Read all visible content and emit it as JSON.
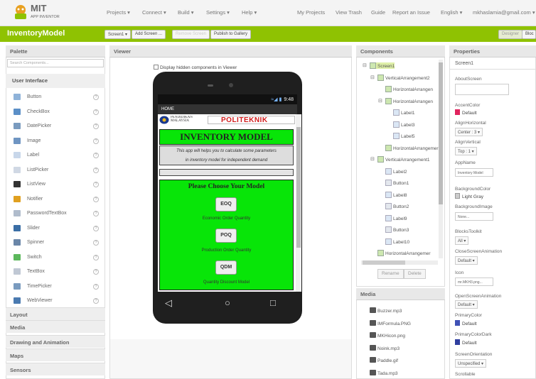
{
  "topbar": {
    "logo_mit": "MIT",
    "logo_sub": "APP INVENTOR",
    "menus": [
      "Projects ▾",
      "Connect ▾",
      "Build ▾",
      "Settings ▾",
      "Help ▾"
    ],
    "right_links": [
      "My Projects",
      "View Trash",
      "Guide",
      "Report an Issue",
      "English ▾",
      "mkhaslamia@gmail.com ▾"
    ]
  },
  "toolbar": {
    "project_name": "InventoryModel",
    "screen_select": "Screen1 ▾",
    "add_screen": "Add Screen ...",
    "remove_screen": "Remove Screen",
    "publish": "Publish to Gallery",
    "designer": "Designer",
    "blocks": "Bloc"
  },
  "palette": {
    "header": "Palette",
    "search_placeholder": "Search Components...",
    "category_open": "User Interface",
    "items": [
      {
        "label": "Button",
        "icon": "button-icon",
        "color": "#8fb3d9"
      },
      {
        "label": "CheckBox",
        "icon": "checkbox-icon",
        "color": "#5b8fc7"
      },
      {
        "label": "DatePicker",
        "icon": "datepicker-icon",
        "color": "#7a9bbf"
      },
      {
        "label": "Image",
        "icon": "image-icon",
        "color": "#6f95c2"
      },
      {
        "label": "Label",
        "icon": "label-icon",
        "color": "#c8d7ea"
      },
      {
        "label": "ListPicker",
        "icon": "listpicker-icon",
        "color": "#d0d8e4"
      },
      {
        "label": "ListView",
        "icon": "listview-icon",
        "color": "#333333"
      },
      {
        "label": "Notifier",
        "icon": "notifier-icon",
        "color": "#e0a020"
      },
      {
        "label": "PasswordTextBox",
        "icon": "password-icon",
        "color": "#b0bccc"
      },
      {
        "label": "Slider",
        "icon": "slider-icon",
        "color": "#3a6ea5"
      },
      {
        "label": "Spinner",
        "icon": "spinner-icon",
        "color": "#6a86a8"
      },
      {
        "label": "Switch",
        "icon": "switch-icon",
        "color": "#5cb85c"
      },
      {
        "label": "TextBox",
        "icon": "textbox-icon",
        "color": "#c0c8d4"
      },
      {
        "label": "TimePicker",
        "icon": "timepicker-icon",
        "color": "#7a9bbf"
      },
      {
        "label": "WebViewer",
        "icon": "webviewer-icon",
        "color": "#4a7ab0"
      }
    ],
    "help": "?",
    "categories": [
      "Layout",
      "Media",
      "Drawing and Animation",
      "Maps",
      "Sensors"
    ]
  },
  "viewer": {
    "header": "Viewer",
    "checkbox_label": "Display hidden components in Viewer",
    "status_time": "9:48",
    "status_icons": "≈◢ ▮",
    "app_title": "HOME",
    "logo_left": "PENDIDIKAN MALAYSIA",
    "logo_right": "POLITEKNIK",
    "title": "INVENTORY MODEL",
    "description_1": "This app will helps you to calculate some parameters",
    "description_2": "in inventory model for independent demand",
    "choose": "Please Choose Your Model",
    "models": [
      {
        "button": "EOQ",
        "label": "Economic Order Quantity"
      },
      {
        "button": "POQ",
        "label": "Production Order Quantity"
      },
      {
        "button": "QDM",
        "label": "Quantity Discount Model"
      }
    ],
    "nav": [
      "◁",
      "○",
      "□"
    ]
  },
  "components": {
    "header": "Components",
    "tree": [
      {
        "label": "Screen1",
        "type": "screen",
        "exp": "⊟"
      },
      {
        "label": "VerticalArrangement2",
        "type": "arr",
        "exp": "⊟"
      },
      {
        "label": "HorizontalArrangen",
        "type": "arr",
        "exp": ""
      },
      {
        "label": "HorizontalArrangen",
        "type": "arr",
        "exp": "⊟"
      },
      {
        "label": "Label1",
        "type": "lab",
        "exp": ""
      },
      {
        "label": "Label3",
        "type": "lab",
        "exp": ""
      },
      {
        "label": "Label5",
        "type": "lab",
        "exp": ""
      },
      {
        "label": "HorizontalArrangemer",
        "type": "arr",
        "exp": ""
      },
      {
        "label": "VerticalArrangement1",
        "type": "arr",
        "exp": "⊟"
      },
      {
        "label": "Label2",
        "type": "lab",
        "exp": ""
      },
      {
        "label": "Button1",
        "type": "btn",
        "exp": ""
      },
      {
        "label": "Label8",
        "type": "lab",
        "exp": ""
      },
      {
        "label": "Button2",
        "type": "btn",
        "exp": ""
      },
      {
        "label": "Label9",
        "type": "lab",
        "exp": ""
      },
      {
        "label": "Button3",
        "type": "btn",
        "exp": ""
      },
      {
        "label": "Label10",
        "type": "lab",
        "exp": ""
      },
      {
        "label": "HorizontalArrangemer",
        "type": "arr",
        "exp": ""
      }
    ],
    "rename": "Rename",
    "delete": "Delete"
  },
  "media": {
    "header": "Media",
    "files": [
      "Buzzer.mp3",
      "IMFormula.PNG",
      "MKHicon.png",
      "Noink.mp3",
      "Paddle.gif",
      "Tada.mp3"
    ]
  },
  "properties": {
    "header": "Properties",
    "screen": "Screen1",
    "about_label": "AboutScreen",
    "accent_label": "AccentColor",
    "accent_value": "Default",
    "accent_color": "#e0245e",
    "alignh_label": "AlignHorizontal",
    "alignh_value": "Center : 3 ▾",
    "alignv_label": "AlignVertical",
    "alignv_value": "Top : 1 ▾",
    "appname_label": "AppName",
    "appname_value": "Inventory Model",
    "bg_label": "BackgroundColor",
    "bg_value": "Light Gray",
    "bgimg_label": "BackgroundImage",
    "bgimg_value": "None...",
    "blocks_label": "BlocksToolkit",
    "blocks_value": "All ▾",
    "close_label": "CloseScreenAnimation",
    "close_value": "Default ▾",
    "icon_label": "Icon",
    "icon_value": "mr.MKH3.png...",
    "open_label": "OpenScreenAnimation",
    "open_value": "Default ▾",
    "primary_label": "PrimaryColor",
    "primary_value": "Default",
    "primary_color": "#3f51b5",
    "primarydark_label": "PrimaryColorDark",
    "primarydark_value": "Default",
    "primarydark_color": "#303f9f",
    "orient_label": "ScreenOrientation",
    "orient_value": "Unspecified ▾",
    "scrollable_label": "Scrollable"
  }
}
